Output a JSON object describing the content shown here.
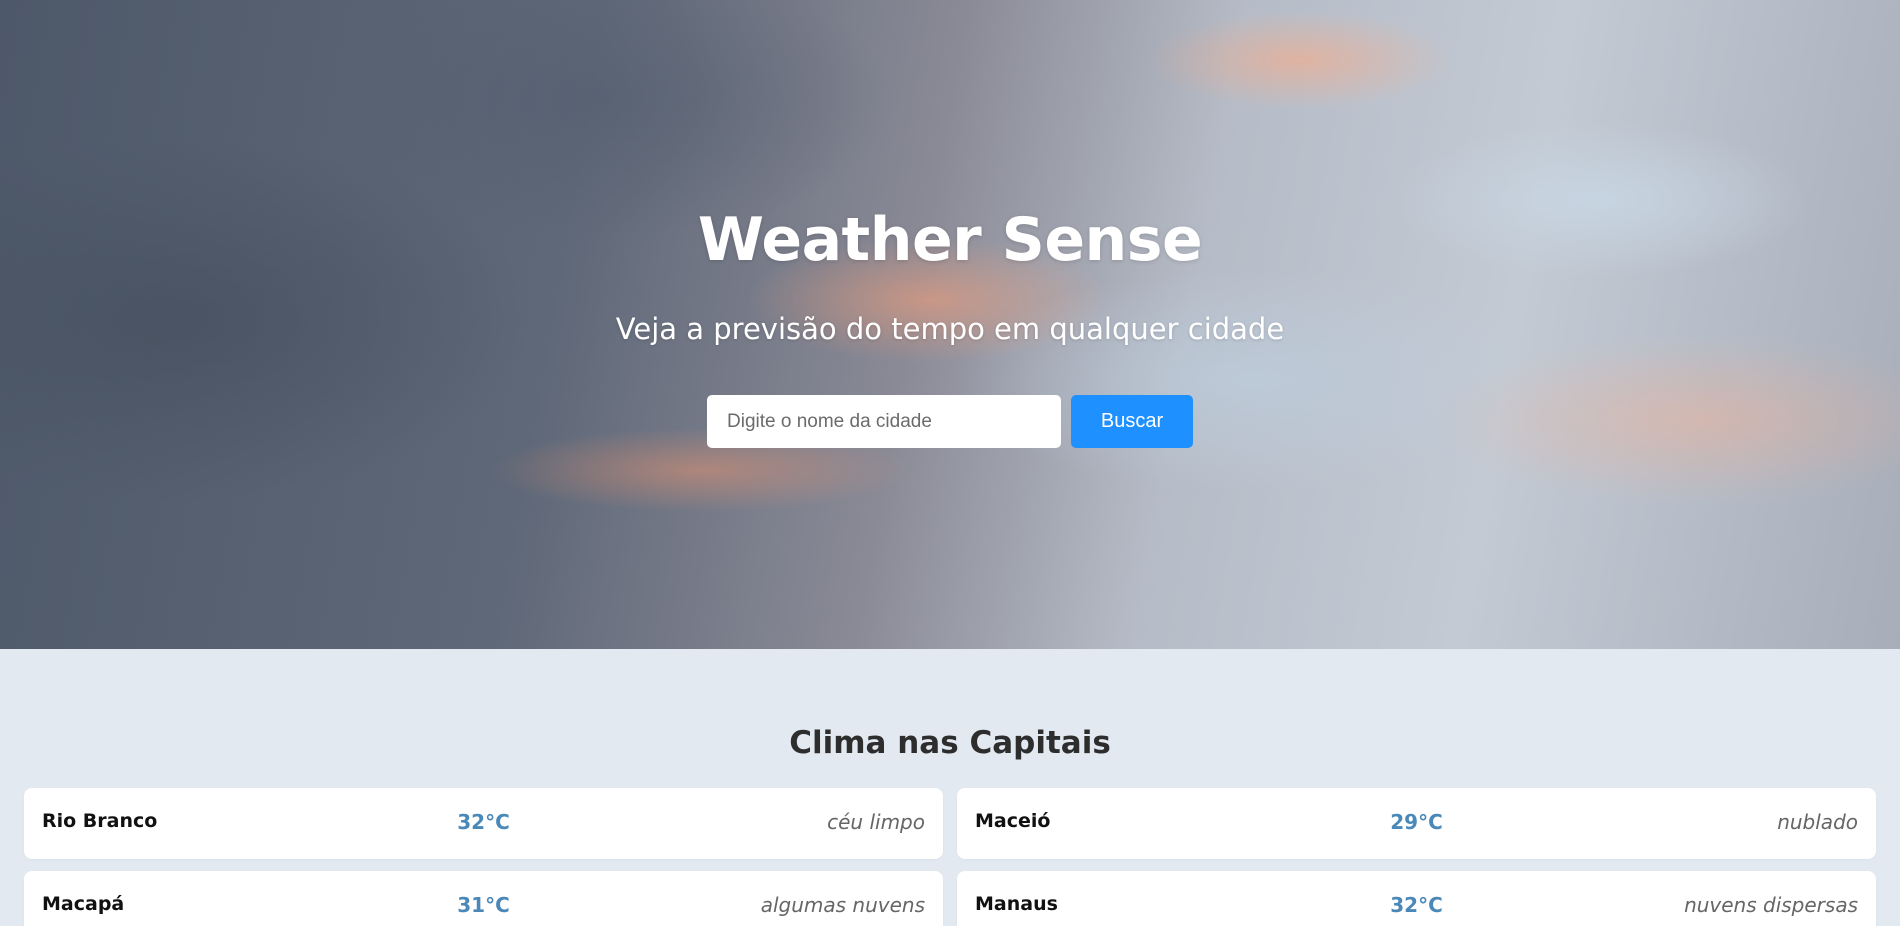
{
  "hero": {
    "title": "Weather Sense",
    "subtitle": "Veja a previsão do tempo em qualquer cidade",
    "search": {
      "placeholder": "Digite o nome da cidade",
      "value": "",
      "button_label": "Buscar"
    }
  },
  "capitals": {
    "title": "Clima nas Capitais",
    "cards": [
      {
        "city": "Rio Branco",
        "temp": "32°C",
        "description": "céu limpo"
      },
      {
        "city": "Maceió",
        "temp": "29°C",
        "description": "nublado"
      },
      {
        "city": "Macapá",
        "temp": "31°C",
        "description": "algumas nuvens"
      },
      {
        "city": "Manaus",
        "temp": "32°C",
        "description": "nuvens dispersas"
      }
    ]
  },
  "colors": {
    "accent": "#1e90ff",
    "temperature": "#4a88b8",
    "section_background": "#e3e9f1"
  }
}
